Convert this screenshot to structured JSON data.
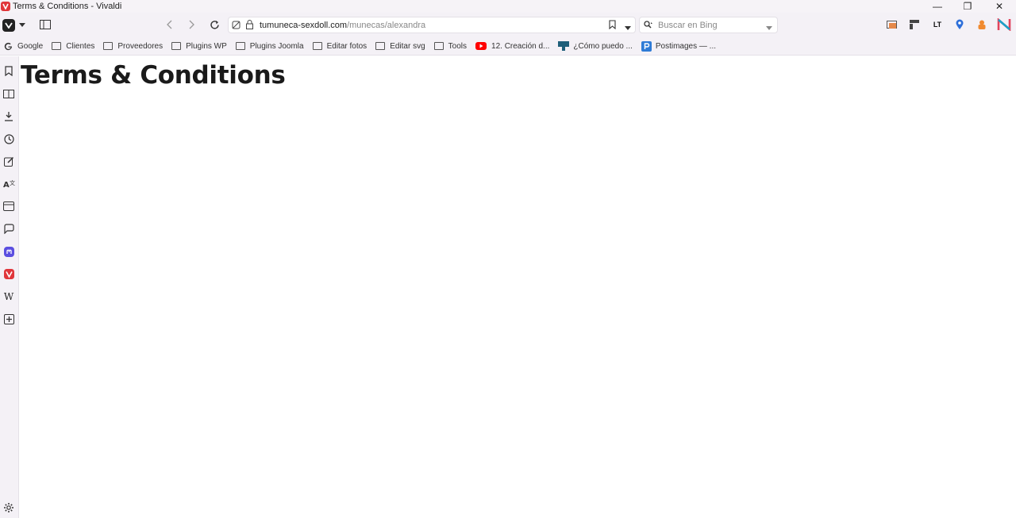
{
  "window": {
    "title": "Terms & Conditions - Vivaldi",
    "controls": {
      "minimize": "—",
      "maximize": "❐",
      "close": "✕"
    }
  },
  "toolbar": {
    "url_host": "tumuneca-sexdoll.com",
    "url_path": "/munecas/alexandra",
    "search_placeholder": "Buscar en Bing"
  },
  "bookmarks": [
    {
      "label": "Google",
      "icon": "google-icon"
    },
    {
      "label": "Clientes",
      "icon": "folder-icon"
    },
    {
      "label": "Proveedores",
      "icon": "folder-icon"
    },
    {
      "label": "Plugins WP",
      "icon": "folder-icon"
    },
    {
      "label": "Plugins Joomla",
      "icon": "folder-icon"
    },
    {
      "label": "Editar fotos",
      "icon": "folder-icon"
    },
    {
      "label": "Editar svg",
      "icon": "folder-icon"
    },
    {
      "label": "Tools",
      "icon": "folder-icon"
    },
    {
      "label": "12. Creación d...",
      "icon": "youtube-icon"
    },
    {
      "label": "¿Cómo puedo ...",
      "icon": "site-icon"
    },
    {
      "label": "Postimages — ...",
      "icon": "postimages-icon"
    }
  ],
  "page": {
    "heading": "Terms & Conditions"
  },
  "colors": {
    "vivaldi_red": "#e0363b",
    "chrome_bg": "#f4f1f6",
    "youtube_red": "#ff0000",
    "postimages_blue": "#2f7bd6"
  }
}
